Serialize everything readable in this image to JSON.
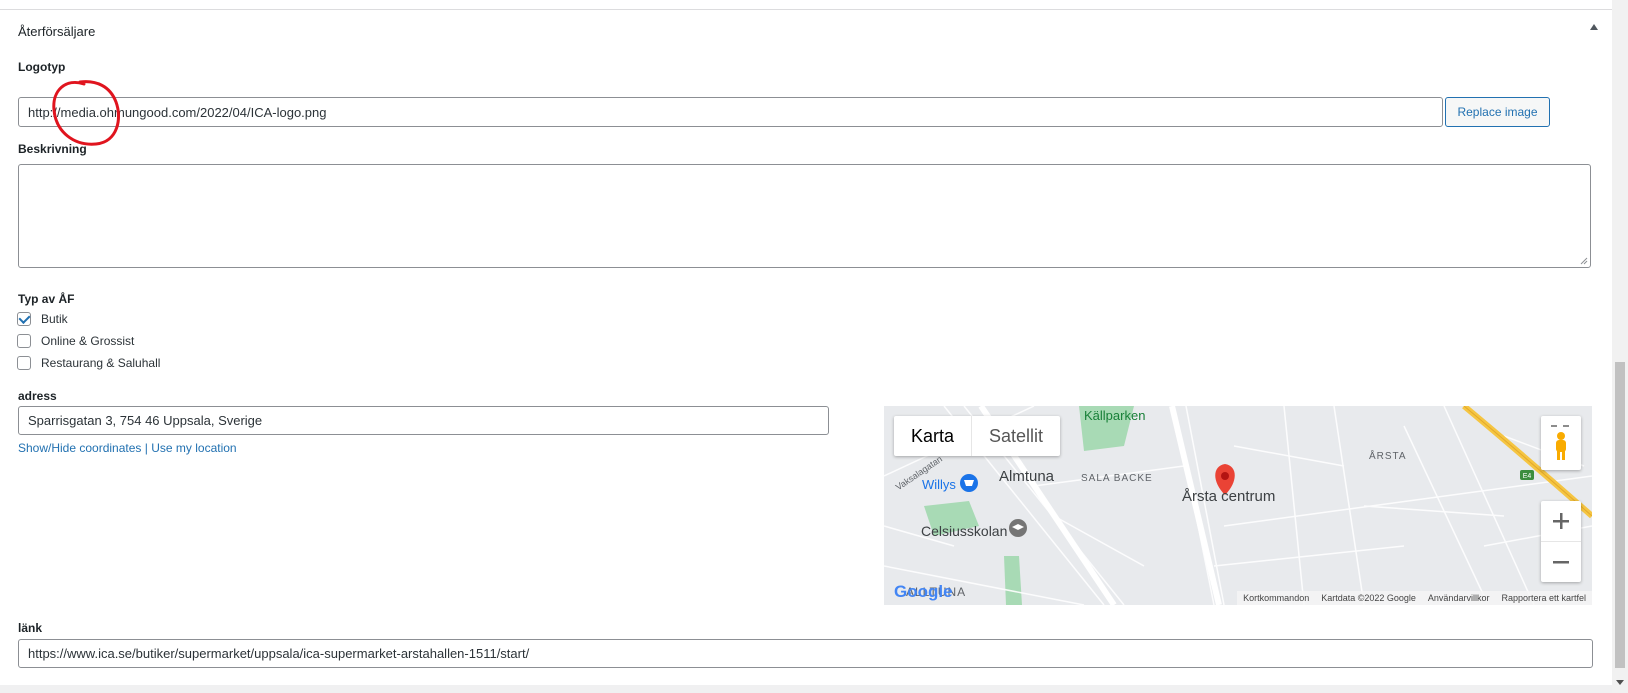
{
  "section": {
    "title": "Återförsäljare"
  },
  "logo": {
    "label": "Logotyp",
    "url_value": "http://media.ohmungood.com/2022/04/ICA-logo.png",
    "replace_button": "Replace image"
  },
  "description": {
    "label": "Beskrivning",
    "value": ""
  },
  "type": {
    "label": "Typ av ÅF",
    "options": [
      {
        "label": "Butik",
        "checked": true
      },
      {
        "label": "Online & Grossist",
        "checked": false
      },
      {
        "label": "Restaurang & Saluhall",
        "checked": false
      }
    ]
  },
  "address": {
    "label": "adress",
    "value": "Sparrisgatan 3, 754 46 Uppsala, Sverige",
    "show_hide_link": "Show/Hide coordinates",
    "separator": "|",
    "use_location_link": "Use my location"
  },
  "map": {
    "type_map": "Karta",
    "type_satellite": "Satellit",
    "labels": {
      "kallparken": "Källparken",
      "almtuna": "Almtuna",
      "sala_backe": "SALA BACKE",
      "arsta": "ÅRSTA",
      "arsta_centrum": "Årsta centrum",
      "willys": "Willys",
      "celsiusskolan": "Celsiusskolan",
      "vaksalagatan": "Vaksalagatan",
      "alltuna": "ALLTUNA",
      "e4": "E4"
    },
    "attribution": {
      "shortcuts": "Kortkommandon",
      "data": "Kartdata ©2022 Google",
      "terms": "Användarvillkor",
      "report": "Rapportera ett kartfel"
    },
    "google": "Google",
    "colors": {
      "pin": "#ea4335",
      "park": "#a8dab5",
      "road_highway": "#f5c542"
    }
  },
  "link": {
    "label": "länk",
    "value": "https://www.ica.se/butiker/supermarket/uppsala/ica-supermarket-arstahallen-1511/start/"
  }
}
